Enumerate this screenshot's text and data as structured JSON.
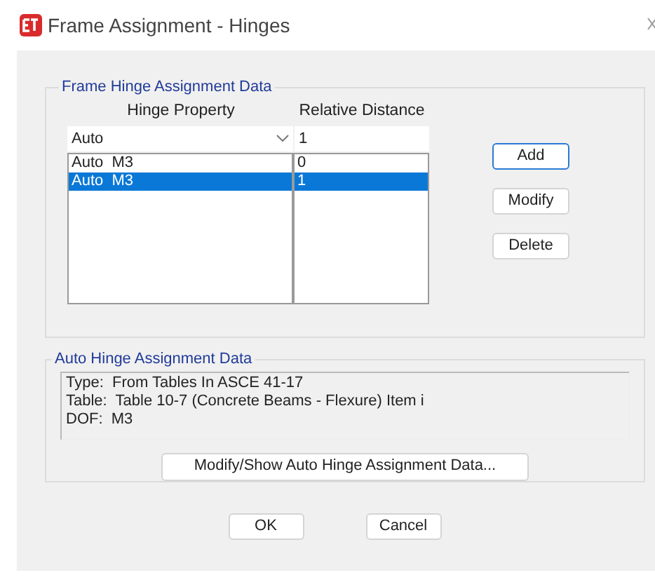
{
  "window": {
    "title": "Frame Assignment - Hinges"
  },
  "hinge_group": {
    "title": "Frame Hinge Assignment Data",
    "columns": [
      "Hinge Property",
      "Relative Distance"
    ],
    "property_value": "Auto",
    "distance_value": "1",
    "rows": [
      {
        "property": "Auto  M3",
        "distance": "0",
        "selected": false
      },
      {
        "property": "Auto  M3",
        "distance": "1",
        "selected": true
      }
    ],
    "buttons": [
      {
        "label": "Add",
        "focused": true
      },
      {
        "label": "Modify",
        "focused": false
      },
      {
        "label": "Delete",
        "focused": false
      }
    ]
  },
  "auto_group": {
    "title": "Auto Hinge Assignment Data",
    "lines": [
      "Type:  From Tables In ASCE 41-17",
      "Table:  Table 10-7 (Concrete Beams - Flexure) Item i",
      "DOF:  M3"
    ],
    "button": "Modify/Show Auto Hinge Assignment Data..."
  },
  "buttons": [
    "OK",
    "Cancel"
  ]
}
